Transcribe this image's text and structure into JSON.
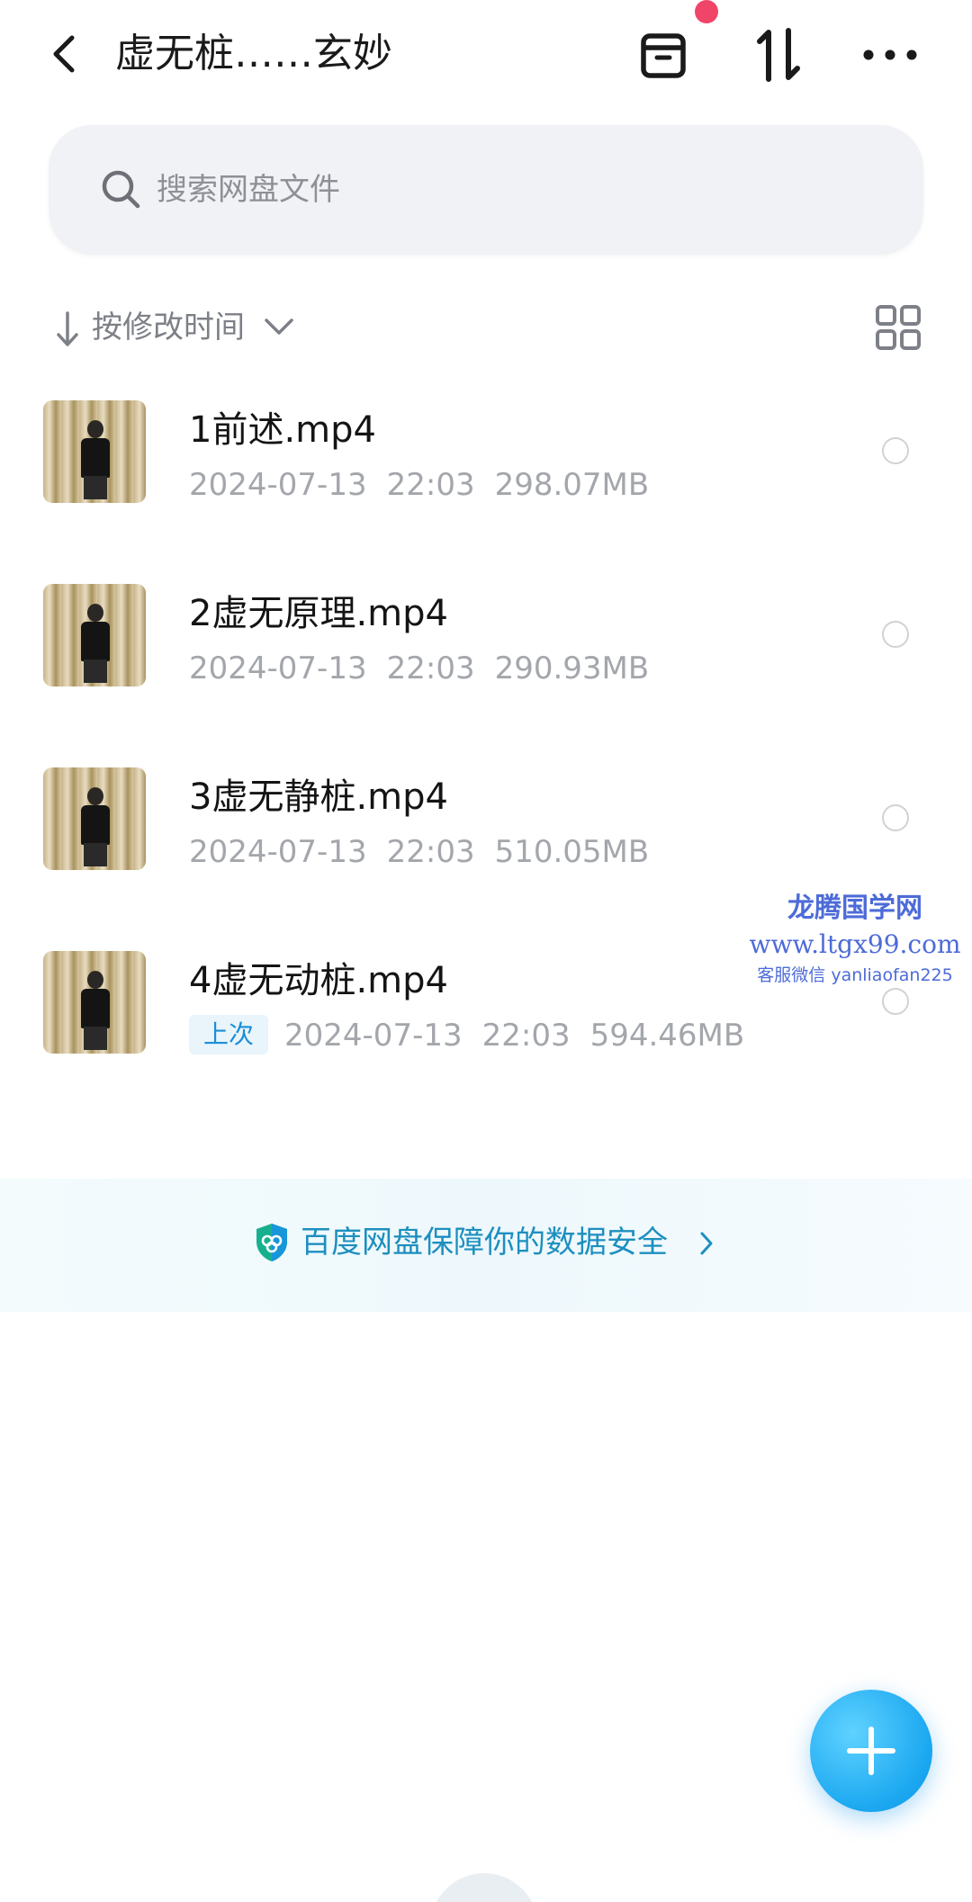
{
  "header": {
    "title": "虚无桩……玄妙",
    "back_icon": "chevron-left-icon",
    "archive_icon": "archive-icon",
    "sort_icon": "sort-arrows-icon",
    "more_icon": "more-dots-icon",
    "notification_dot_color": "#f04468"
  },
  "search": {
    "placeholder": "搜索网盘文件",
    "icon": "search-icon"
  },
  "sort": {
    "label": "按修改时间",
    "arrow_icon": "arrow-down-icon",
    "chevron_icon": "chevron-down-icon",
    "view_toggle_icon": "grid-view-icon"
  },
  "files": [
    {
      "name": "1前述.mp4",
      "date": "2024-07-13",
      "time": "22:03",
      "size": "298.07MB",
      "badge": ""
    },
    {
      "name": "2虚无原理.mp4",
      "date": "2024-07-13",
      "time": "22:03",
      "size": "290.93MB",
      "badge": ""
    },
    {
      "name": "3虚无静桩.mp4",
      "date": "2024-07-13",
      "time": "22:03",
      "size": "510.05MB",
      "badge": ""
    },
    {
      "name": "4虚无动桩.mp4",
      "date": "2024-07-13",
      "time": "22:03",
      "size": "594.46MB",
      "badge": "上次"
    }
  ],
  "watermark": {
    "name": "龙腾国学网",
    "url": "www.ltgx99.com",
    "contact": "客服微信 yanliaofan225"
  },
  "security_banner": {
    "text": "百度网盘保障你的数据安全",
    "icon": "shield-icon",
    "chevron_icon": "chevron-right-icon",
    "color": "#1d8fbf"
  },
  "fab": {
    "icon": "plus-icon",
    "color": "#1aa7f0"
  }
}
